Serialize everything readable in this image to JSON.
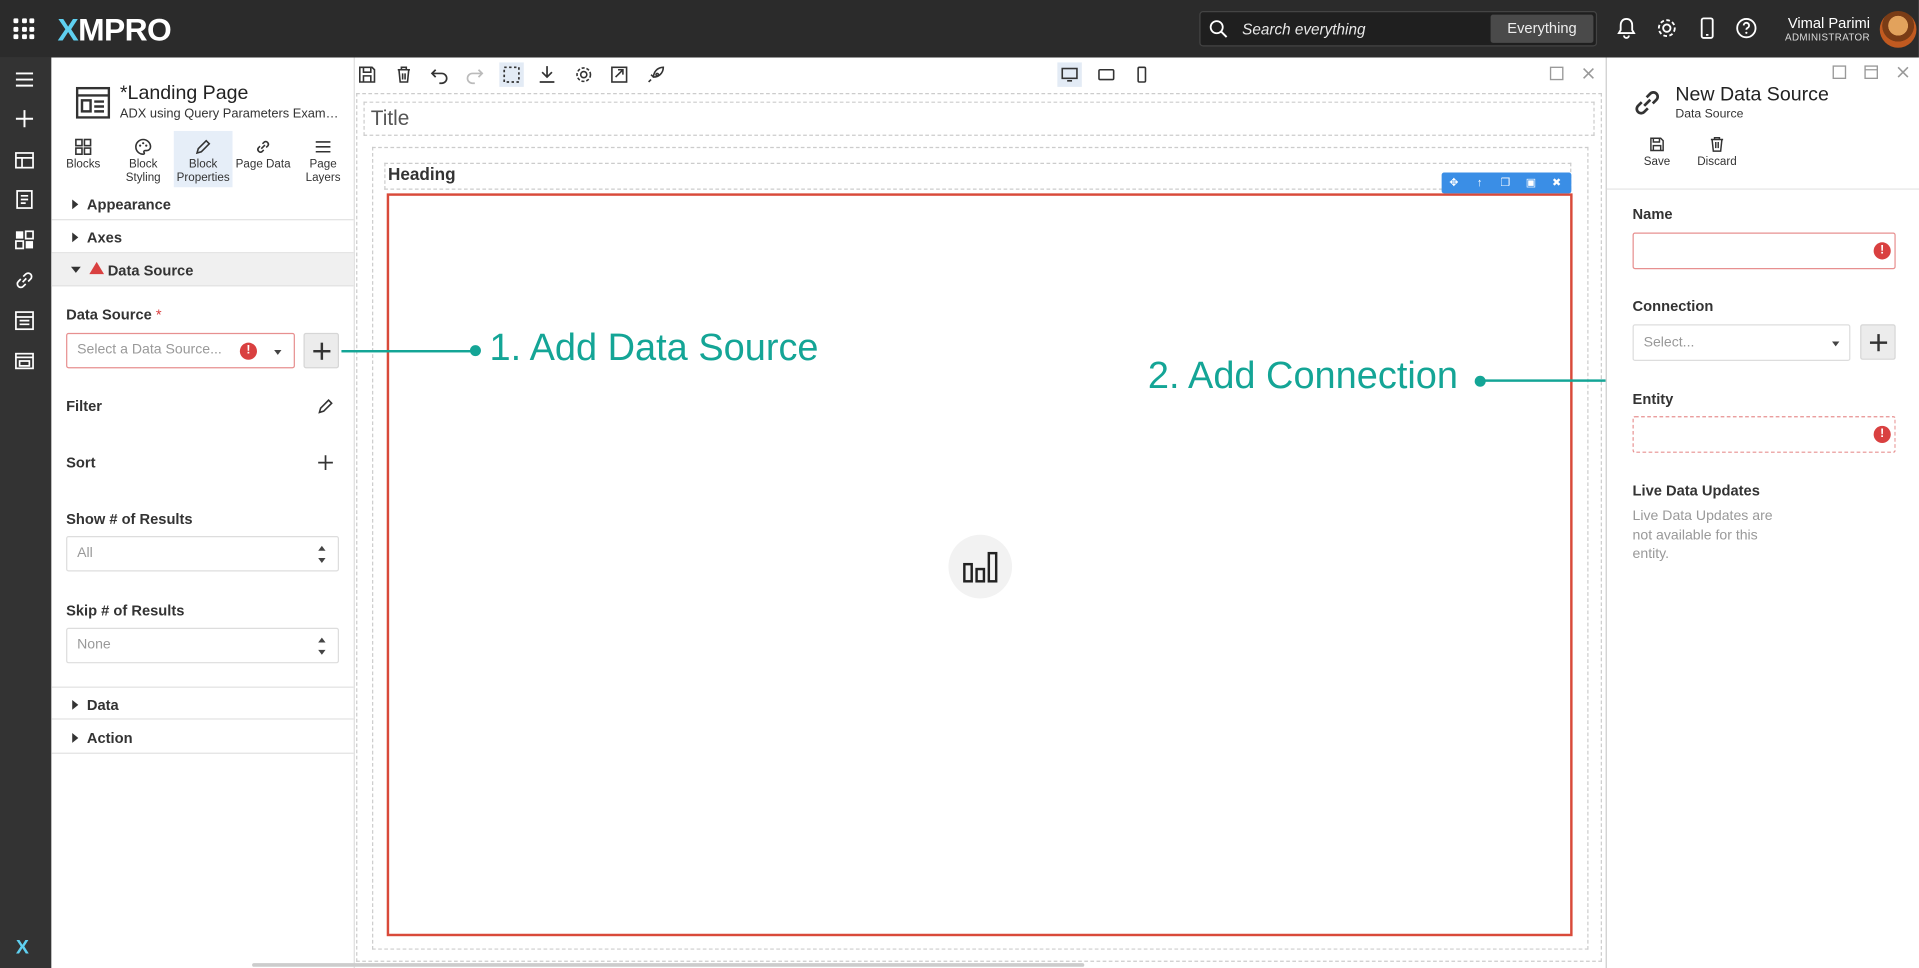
{
  "topbar": {
    "logo": "XMPRO",
    "search_placeholder": "Search everything",
    "search_scope": "Everything",
    "user_name": "Vimal Parimi",
    "user_role": "ADMINISTRATOR",
    "icons": [
      "apps-grid-icon",
      "bell-icon",
      "gear-icon",
      "mobile-icon",
      "help-icon"
    ]
  },
  "left_panel": {
    "page_title": "*Landing Page",
    "page_subtitle": "ADX using Query Parameters Exampl...",
    "tabs": [
      {
        "label": "Blocks"
      },
      {
        "label": "Block Styling"
      },
      {
        "label": "Block Properties"
      },
      {
        "label": "Page Data"
      },
      {
        "label": "Page Layers"
      }
    ],
    "sections": {
      "appearance": "Appearance",
      "axes": "Axes",
      "data_source": "Data Source",
      "data": "Data",
      "action": "Action"
    },
    "fields": {
      "data_source_label": "Data Source",
      "required_mark": "*",
      "data_source_placeholder": "Select a Data Source...",
      "filter_label": "Filter",
      "sort_label": "Sort",
      "show_results_label": "Show # of Results",
      "show_results_value": "All",
      "skip_results_label": "Skip # of Results",
      "skip_results_value": "None"
    }
  },
  "canvas": {
    "title_placeholder": "Title",
    "heading": "Heading"
  },
  "annotations": {
    "step1": "1. Add Data Source",
    "step2": "2. Add Connection"
  },
  "right_panel": {
    "title": "New Data Source",
    "subtitle": "Data Source",
    "save": "Save",
    "discard": "Discard",
    "name_label": "Name",
    "connection_label": "Connection",
    "connection_placeholder": "Select...",
    "entity_label": "Entity",
    "live_label": "Live Data Updates",
    "live_note": "Live Data Updates are not available for this entity."
  },
  "colors": {
    "accent_teal": "#14a596",
    "error_red": "#d94040",
    "topbar_bg": "#2b2b2b",
    "selection_blue": "#3a8ee6"
  }
}
